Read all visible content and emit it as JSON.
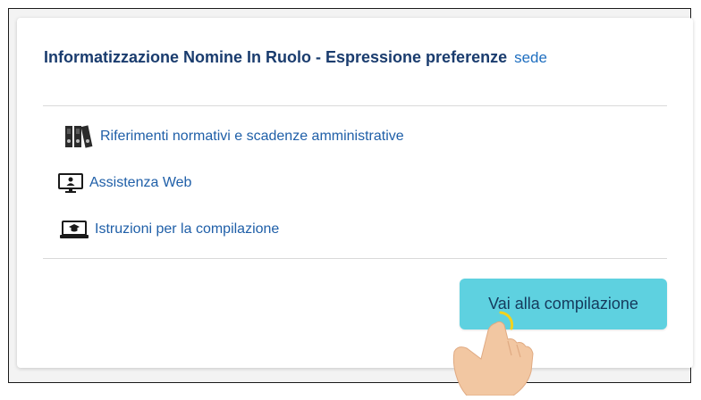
{
  "header": {
    "title": "Informatizzazione Nomine In Ruolo - Espressione preferenze",
    "subtitle": "sede"
  },
  "links": [
    {
      "label": "Riferimenti normativi e scadenze amministrative",
      "icon": "binders-icon"
    },
    {
      "label": "Assistenza Web",
      "icon": "monitor-user-icon"
    },
    {
      "label": "Istruzioni per la compilazione",
      "icon": "laptop-graduation-icon"
    }
  ],
  "action": {
    "label": "Vai alla compilazione"
  },
  "colors": {
    "title": "#1a3c6e",
    "link": "#1f5fa8",
    "button_bg": "#5ed1e0"
  },
  "cursor": {
    "icon": "pointing-hand-icon"
  }
}
